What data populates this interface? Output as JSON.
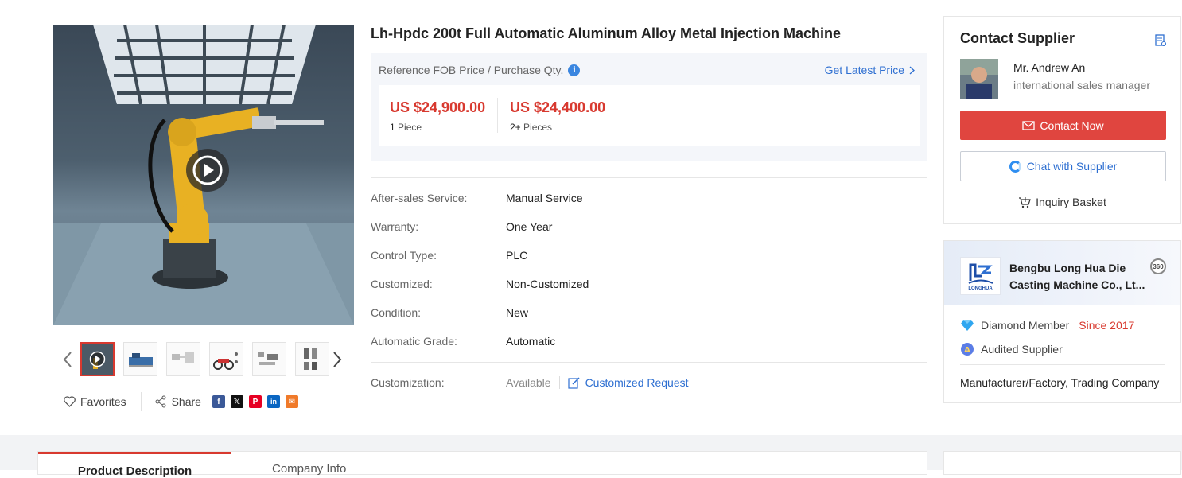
{
  "product": {
    "title": "Lh-Hpdc 200t Full Automatic Aluminum Alloy Metal Injection Machine"
  },
  "gallery": {
    "main_media": "robot-arm-video",
    "thumbnails": [
      "video-robot-arm",
      "machine-photo",
      "diagram-sheet",
      "motorcycle-parts",
      "parts-sheet",
      "parts-set"
    ],
    "active_index": 0,
    "favorites_label": "Favorites",
    "share_label": "Share",
    "social": [
      {
        "name": "facebook",
        "glyph": "f",
        "color": "#3b5998"
      },
      {
        "name": "x",
        "glyph": "𝕏",
        "color": "#111111"
      },
      {
        "name": "pinterest",
        "glyph": "P",
        "color": "#e60023"
      },
      {
        "name": "linkedin",
        "glyph": "in",
        "color": "#0a66c2"
      },
      {
        "name": "email",
        "glyph": "✉",
        "color": "#f07a2a"
      }
    ]
  },
  "pricing": {
    "reference_label": "Reference FOB Price / Purchase Qty.",
    "latest_price_link": "Get Latest Price",
    "tiers": [
      {
        "price": "US $24,900.00",
        "qty_num": "1",
        "qty_unit": "Piece"
      },
      {
        "price": "US $24,400.00",
        "qty_num": "2+",
        "qty_unit": "Pieces"
      }
    ]
  },
  "attributes": [
    {
      "key": "After-sales Service:",
      "value": "Manual Service"
    },
    {
      "key": "Warranty:",
      "value": "One Year"
    },
    {
      "key": "Control Type:",
      "value": "PLC"
    },
    {
      "key": "Customized:",
      "value": "Non-Customized"
    },
    {
      "key": "Condition:",
      "value": "New"
    },
    {
      "key": "Automatic Grade:",
      "value": "Automatic"
    }
  ],
  "customization": {
    "key": "Customization:",
    "value": "Available",
    "link": "Customized Request"
  },
  "supplier": {
    "heading": "Contact Supplier",
    "rep_name": "Mr. Andrew An",
    "rep_title": "international sales manager",
    "contact_now": "Contact Now",
    "chat": "Chat with Supplier",
    "basket": "Inquiry Basket"
  },
  "company": {
    "name": "Bengbu Long Hua Die Casting Machine Co., Lt...",
    "logo_text": "LONGHUA",
    "badge": "360",
    "member_level": "Diamond Member",
    "member_since": "Since 2017",
    "audited": "Audited Supplier",
    "business_type": "Manufacturer/Factory, Trading Company"
  },
  "tabs": [
    "Product Description",
    "Company Info"
  ],
  "colors": {
    "accent_red": "#d8392f",
    "link_blue": "#2e6fd1",
    "contact_button": "#e0453f"
  }
}
